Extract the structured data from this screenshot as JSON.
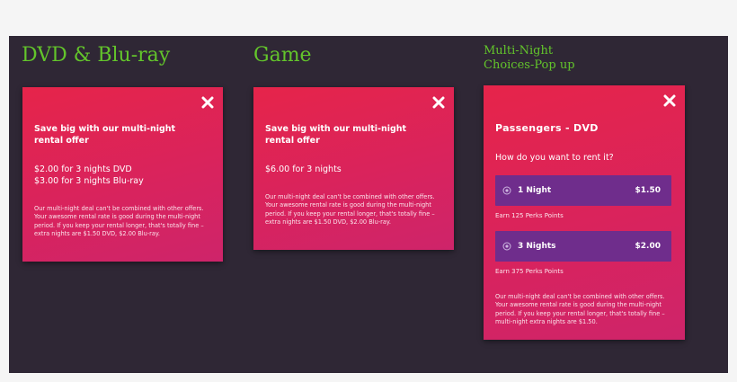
{
  "columns": [
    {
      "title": "DVD & Blu-ray"
    },
    {
      "title": "Game"
    },
    {
      "title_lines": [
        "Multi-Night",
        "Choices-Pop up"
      ]
    }
  ],
  "dvd_card": {
    "headline": "Save big with our multi-night rental offer",
    "prices": [
      "$2.00 for 3 nights DVD",
      "$3.00  for 3 nights Blu-ray"
    ],
    "fine_print": "Our multi-night deal can't be combined with other offers. Your awesome rental rate is good during the multi-night period. If you keep your rental longer, that's totally fine – extra nights are $1.50 DVD, $2.00 Blu-ray."
  },
  "game_card": {
    "headline": "Save big with our multi-night rental offer",
    "prices": [
      "$6.00 for 3 nights"
    ],
    "fine_print": "Our multi-night deal can't be combined with other offers. Your awesome rental rate is good during the multi-night period. If you keep your rental longer, that's totally fine – extra nights are $1.50 DVD, $2.00 Blu-ray."
  },
  "popup": {
    "title": "Passengers - DVD",
    "question": "How do you want to rent it?",
    "options": [
      {
        "label": "1 Night",
        "price": "$1.50",
        "perks": "Earn 125 Perks Points"
      },
      {
        "label": "3 Nights",
        "price": "$2.00",
        "perks": "Earn 375 Perks Points"
      }
    ],
    "fine_print": "Our multi-night deal can't be combined with other offers. Your awesome rental rate is good during the multi-night period. If you keep your rental longer, that's totally fine – multi-night extra nights are $1.50."
  },
  "colors": {
    "background": "#2f2735",
    "title_green": "#63c52b",
    "card_red": "#e6244a",
    "option_purple": "#6f2d8c"
  },
  "icons": {
    "close": "close-icon",
    "radio": "radio-icon"
  }
}
